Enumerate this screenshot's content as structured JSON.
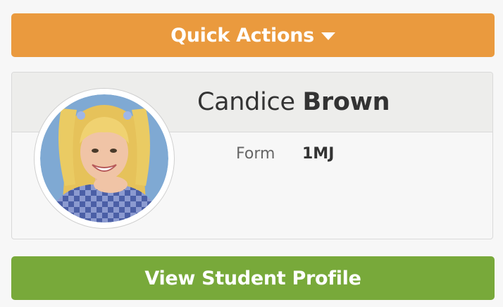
{
  "quick_actions": {
    "label": "Quick Actions",
    "icon": "caret-down-icon",
    "color": "#ea9a3e"
  },
  "student": {
    "first_name": "Candice",
    "last_name": "Brown",
    "form_label": "Form",
    "form_value": "1MJ",
    "photo": "student-photo"
  },
  "profile_button": {
    "label": "View Student Profile",
    "color": "#78a93a"
  }
}
